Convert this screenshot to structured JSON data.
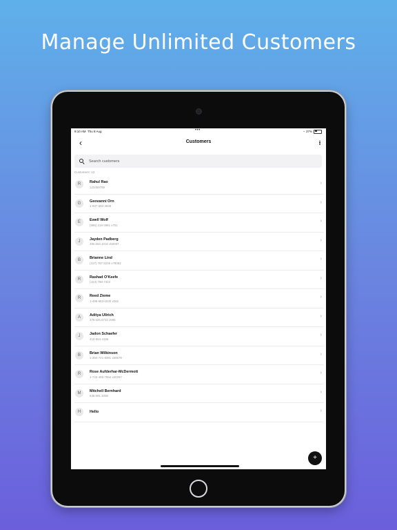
{
  "headline": "Manage Unlimited Customers",
  "status_bar": {
    "time": "9:10 AM",
    "date": "Thu 8 Aug",
    "dots": "•••",
    "battery": "37%"
  },
  "nav": {
    "title": "Customers"
  },
  "search": {
    "placeholder": "Search customers",
    "value": ""
  },
  "customers_count_label": "Customers: 13",
  "customers": [
    {
      "initial": "R",
      "name": "Rahul Rao",
      "phone": "123459789"
    },
    {
      "initial": "G",
      "name": "Geovanni Orn",
      "phone": "1-937-692-4949"
    },
    {
      "initial": "E",
      "name": "Ewell Wolf",
      "phone": "(985) 218-3961 x751"
    },
    {
      "initial": "J",
      "name": "Jayden Padberg",
      "phone": "490.653.1016 x50097"
    },
    {
      "initial": "B",
      "name": "Brianne Lind",
      "phone": "(317) 757-3236 x78082"
    },
    {
      "initial": "R",
      "name": "Rashad O'Keefe",
      "phone": "(423) 768-7322"
    },
    {
      "initial": "R",
      "name": "Reed Zieme",
      "phone": "1-488-663-1620 x062"
    },
    {
      "initial": "A",
      "name": "Aditya Ullrich",
      "phone": "378.526.6734 x965"
    },
    {
      "initial": "J",
      "name": "Jadon Schaefer",
      "phone": "410-554-4186"
    },
    {
      "initial": "B",
      "name": "Brian Wilkinson",
      "phone": "1-394-741-8381 x60679"
    },
    {
      "initial": "R",
      "name": "Rose Aufderhar-McDermott",
      "phone": "1-743-469-7864 x30267"
    },
    {
      "initial": "M",
      "name": "Mitchell Bernhard",
      "phone": "636.591.1008"
    },
    {
      "initial": "H",
      "name": "Hello",
      "phone": ""
    }
  ],
  "fab_label": "+"
}
